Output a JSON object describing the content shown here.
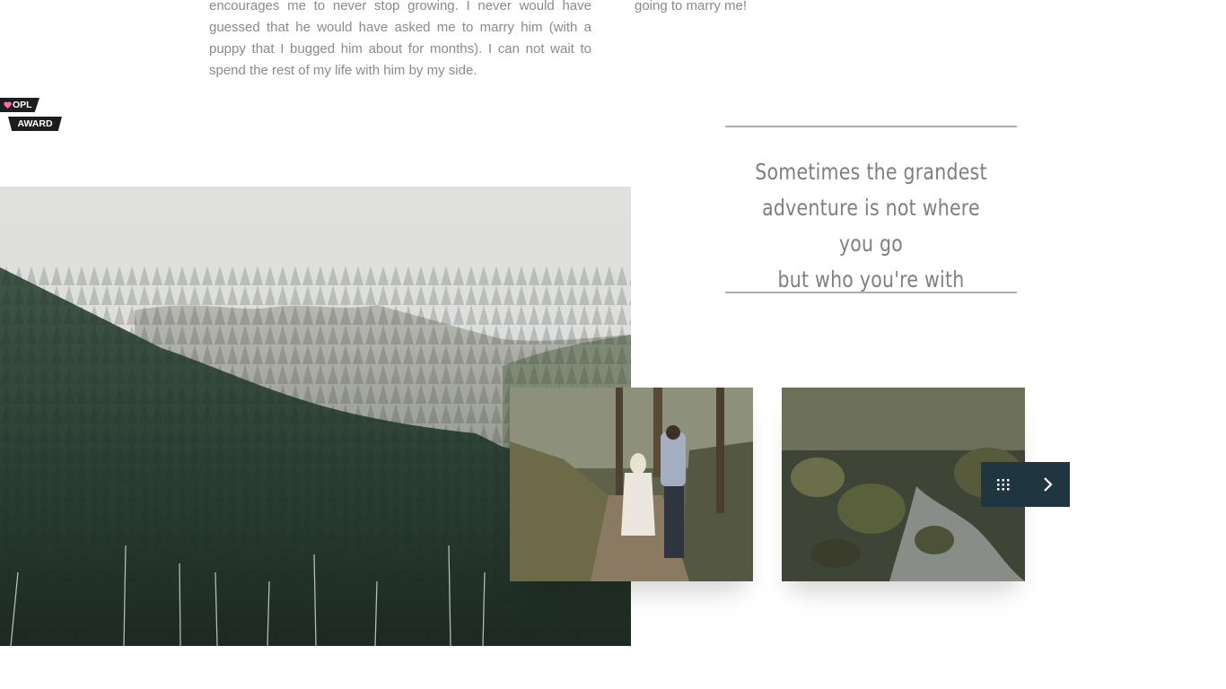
{
  "story": {
    "paragraph": "encourages me to never stop growing. I never would have guessed that he would have asked me to marry him (with a puppy that I bugged him about for months). I can not wait to spend the rest of my life with him by my side.",
    "right_paragraph": "going to marry me!"
  },
  "award": {
    "line1": "OPL",
    "line2": "AWARD",
    "heart_color": "#ff6fae"
  },
  "quote": {
    "line1": "Sometimes the grandest",
    "line2": "adventure is not where you go",
    "line3": "but who you're with"
  },
  "gallery": {
    "images": [
      {
        "name": "forest-mountain-image"
      },
      {
        "name": "couple-hiking-image"
      },
      {
        "name": "forest-stream-image"
      }
    ],
    "controls": {
      "grid_icon": "grid-icon",
      "next_icon": "chevron-right-icon",
      "background": "#1f3540"
    }
  }
}
